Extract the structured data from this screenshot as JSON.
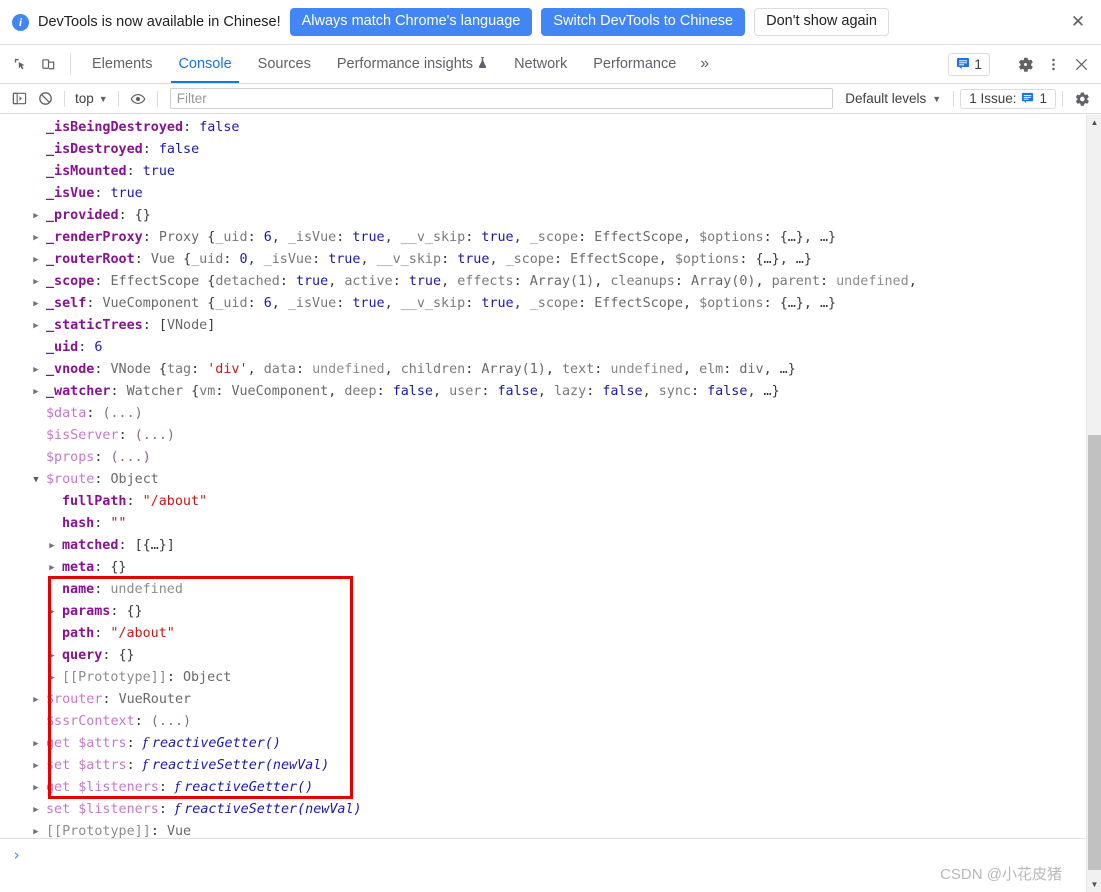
{
  "banner": {
    "icon": "info-icon",
    "message": "DevTools is now available in Chinese!",
    "buttons": [
      {
        "label": "Always match Chrome's language",
        "style": "primary"
      },
      {
        "label": "Switch DevTools to Chinese",
        "style": "primary"
      },
      {
        "label": "Don't show again",
        "style": "ghost"
      }
    ],
    "close_label": "✕"
  },
  "tabbar": {
    "inspect_icon": "inspect-element-icon",
    "device_icon": "device-toolbar-icon",
    "tabs": [
      {
        "label": "Elements",
        "active": false
      },
      {
        "label": "Console",
        "active": true
      },
      {
        "label": "Sources",
        "active": false
      },
      {
        "label": "Performance insights",
        "active": false,
        "badge_icon": "experiment-flask-icon"
      },
      {
        "label": "Network",
        "active": false
      },
      {
        "label": "Performance",
        "active": false
      }
    ],
    "more_label": "»",
    "issue_icon": "issue-message-icon",
    "issue_count": "1",
    "settings_icon": "gear-icon",
    "more_options_icon": "kebab-menu-icon",
    "close_icon": "close-icon"
  },
  "filterbar": {
    "sidebar_icon": "console-sidebar-icon",
    "clear_icon": "clear-console-icon",
    "context": "top",
    "eye_icon": "live-expression-eye-icon",
    "filter_placeholder": "Filter",
    "filter_value": "",
    "levels_label": "Default levels",
    "issue_label": "1 Issue:",
    "issue_icon": "issue-message-icon",
    "issue_count": "1",
    "settings_icon": "console-settings-gear-icon"
  },
  "console": {
    "lines": [
      {
        "id": "l1",
        "indent": 1,
        "arrow": "none",
        "name": "_isBeingDestroyed",
        "nameStyle": "k",
        "sep": ": ",
        "value": "false",
        "valueStyle": "bool"
      },
      {
        "id": "l2",
        "indent": 1,
        "arrow": "none",
        "name": "_isDestroyed",
        "nameStyle": "k",
        "sep": ": ",
        "value": "false",
        "valueStyle": "bool"
      },
      {
        "id": "l3",
        "indent": 1,
        "arrow": "none",
        "name": "_isMounted",
        "nameStyle": "k",
        "sep": ": ",
        "value": "true",
        "valueStyle": "bool"
      },
      {
        "id": "l4",
        "indent": 1,
        "arrow": "none",
        "name": "_isVue",
        "nameStyle": "k",
        "sep": ": ",
        "value": "true",
        "valueStyle": "bool"
      },
      {
        "id": "l5",
        "indent": 1,
        "arrow": "collapsed",
        "name": "_provided",
        "nameStyle": "k",
        "sep": ": ",
        "value": "{}",
        "valueStyle": "punct"
      },
      {
        "id": "l6",
        "indent": 1,
        "arrow": "collapsed",
        "name": "_renderProxy",
        "nameStyle": "k",
        "sep": ": ",
        "valueStyle": "rich",
        "tokens": [
          [
            "cls",
            "Proxy "
          ],
          [
            "punct",
            "{"
          ],
          [
            "sub",
            "_uid"
          ],
          [
            "punct",
            ": "
          ],
          [
            "num",
            "6"
          ],
          [
            "punct",
            ", "
          ],
          [
            "sub",
            "_isVue"
          ],
          [
            "punct",
            ": "
          ],
          [
            "bool",
            "true"
          ],
          [
            "punct",
            ", "
          ],
          [
            "sub",
            "__v_skip"
          ],
          [
            "punct",
            ": "
          ],
          [
            "bool",
            "true"
          ],
          [
            "punct",
            ", "
          ],
          [
            "sub",
            "_scope"
          ],
          [
            "punct",
            ": "
          ],
          [
            "cls",
            "EffectScope"
          ],
          [
            "punct",
            ", "
          ],
          [
            "sub",
            "$options"
          ],
          [
            "punct",
            ": "
          ],
          [
            "punct",
            "{…}"
          ],
          [
            "punct",
            ", …}"
          ]
        ]
      },
      {
        "id": "l7",
        "indent": 1,
        "arrow": "collapsed",
        "name": "_routerRoot",
        "nameStyle": "k",
        "sep": ": ",
        "valueStyle": "rich",
        "tokens": [
          [
            "cls",
            "Vue "
          ],
          [
            "punct",
            "{"
          ],
          [
            "sub",
            "_uid"
          ],
          [
            "punct",
            ": "
          ],
          [
            "num",
            "0"
          ],
          [
            "punct",
            ", "
          ],
          [
            "sub",
            "_isVue"
          ],
          [
            "punct",
            ": "
          ],
          [
            "bool",
            "true"
          ],
          [
            "punct",
            ", "
          ],
          [
            "sub",
            "__v_skip"
          ],
          [
            "punct",
            ": "
          ],
          [
            "bool",
            "true"
          ],
          [
            "punct",
            ", "
          ],
          [
            "sub",
            "_scope"
          ],
          [
            "punct",
            ": "
          ],
          [
            "cls",
            "EffectScope"
          ],
          [
            "punct",
            ", "
          ],
          [
            "sub",
            "$options"
          ],
          [
            "punct",
            ": "
          ],
          [
            "punct",
            "{…}"
          ],
          [
            "punct",
            ", …}"
          ]
        ]
      },
      {
        "id": "l8",
        "indent": 1,
        "arrow": "collapsed",
        "name": "_scope",
        "nameStyle": "k",
        "sep": ": ",
        "valueStyle": "rich",
        "tokens": [
          [
            "cls",
            "EffectScope "
          ],
          [
            "punct",
            "{"
          ],
          [
            "sub",
            "detached"
          ],
          [
            "punct",
            ": "
          ],
          [
            "bool",
            "true"
          ],
          [
            "punct",
            ", "
          ],
          [
            "sub",
            "active"
          ],
          [
            "punct",
            ": "
          ],
          [
            "bool",
            "true"
          ],
          [
            "punct",
            ", "
          ],
          [
            "sub",
            "effects"
          ],
          [
            "punct",
            ": "
          ],
          [
            "cls",
            "Array(1)"
          ],
          [
            "punct",
            ", "
          ],
          [
            "sub",
            "cleanups"
          ],
          [
            "punct",
            ": "
          ],
          [
            "cls",
            "Array(0)"
          ],
          [
            "punct",
            ", "
          ],
          [
            "sub",
            "parent"
          ],
          [
            "punct",
            ": "
          ],
          [
            "undef",
            "undefined"
          ],
          [
            "punct",
            ","
          ]
        ]
      },
      {
        "id": "l9",
        "indent": 1,
        "arrow": "collapsed",
        "name": "_self",
        "nameStyle": "k",
        "sep": ": ",
        "valueStyle": "rich",
        "tokens": [
          [
            "cls",
            "VueComponent "
          ],
          [
            "punct",
            "{"
          ],
          [
            "sub",
            "_uid"
          ],
          [
            "punct",
            ": "
          ],
          [
            "num",
            "6"
          ],
          [
            "punct",
            ", "
          ],
          [
            "sub",
            "_isVue"
          ],
          [
            "punct",
            ": "
          ],
          [
            "bool",
            "true"
          ],
          [
            "punct",
            ", "
          ],
          [
            "sub",
            "__v_skip"
          ],
          [
            "punct",
            ": "
          ],
          [
            "bool",
            "true"
          ],
          [
            "punct",
            ", "
          ],
          [
            "sub",
            "_scope"
          ],
          [
            "punct",
            ": "
          ],
          [
            "cls",
            "EffectScope"
          ],
          [
            "punct",
            ", "
          ],
          [
            "sub",
            "$options"
          ],
          [
            "punct",
            ": "
          ],
          [
            "punct",
            "{…}"
          ],
          [
            "punct",
            ", …}"
          ]
        ]
      },
      {
        "id": "l10",
        "indent": 1,
        "arrow": "collapsed",
        "name": "_staticTrees",
        "nameStyle": "k",
        "sep": ": ",
        "valueStyle": "rich",
        "tokens": [
          [
            "punct",
            "["
          ],
          [
            "cls",
            "VNode"
          ],
          [
            "punct",
            "]"
          ]
        ]
      },
      {
        "id": "l11",
        "indent": 1,
        "arrow": "none",
        "name": "_uid",
        "nameStyle": "k",
        "sep": ": ",
        "value": "6",
        "valueStyle": "num"
      },
      {
        "id": "l12",
        "indent": 1,
        "arrow": "collapsed",
        "name": "_vnode",
        "nameStyle": "k",
        "sep": ": ",
        "valueStyle": "rich",
        "tokens": [
          [
            "cls",
            "VNode "
          ],
          [
            "punct",
            "{"
          ],
          [
            "sub",
            "tag"
          ],
          [
            "punct",
            ": "
          ],
          [
            "str",
            "'div'"
          ],
          [
            "punct",
            ", "
          ],
          [
            "sub",
            "data"
          ],
          [
            "punct",
            ": "
          ],
          [
            "undef",
            "undefined"
          ],
          [
            "punct",
            ", "
          ],
          [
            "sub",
            "children"
          ],
          [
            "punct",
            ": "
          ],
          [
            "cls",
            "Array(1)"
          ],
          [
            "punct",
            ", "
          ],
          [
            "sub",
            "text"
          ],
          [
            "punct",
            ": "
          ],
          [
            "undef",
            "undefined"
          ],
          [
            "punct",
            ", "
          ],
          [
            "sub",
            "elm"
          ],
          [
            "punct",
            ": "
          ],
          [
            "cls",
            "div"
          ],
          [
            "punct",
            ", …}"
          ]
        ]
      },
      {
        "id": "l13",
        "indent": 1,
        "arrow": "collapsed",
        "name": "_watcher",
        "nameStyle": "k",
        "sep": ": ",
        "valueStyle": "rich",
        "tokens": [
          [
            "cls",
            "Watcher "
          ],
          [
            "punct",
            "{"
          ],
          [
            "sub",
            "vm"
          ],
          [
            "punct",
            ": "
          ],
          [
            "cls",
            "VueComponent"
          ],
          [
            "punct",
            ", "
          ],
          [
            "sub",
            "deep"
          ],
          [
            "punct",
            ": "
          ],
          [
            "bool",
            "false"
          ],
          [
            "punct",
            ", "
          ],
          [
            "sub",
            "user"
          ],
          [
            "punct",
            ": "
          ],
          [
            "bool",
            "false"
          ],
          [
            "punct",
            ", "
          ],
          [
            "sub",
            "lazy"
          ],
          [
            "punct",
            ": "
          ],
          [
            "bool",
            "false"
          ],
          [
            "punct",
            ", "
          ],
          [
            "sub",
            "sync"
          ],
          [
            "punct",
            ": "
          ],
          [
            "bool",
            "false"
          ],
          [
            "punct",
            ", …}"
          ]
        ]
      },
      {
        "id": "l14",
        "indent": 1,
        "arrow": "none",
        "name": "$data",
        "nameStyle": "k-dim",
        "sep": ": ",
        "value": "(...)",
        "valueStyle": "dots"
      },
      {
        "id": "l15",
        "indent": 1,
        "arrow": "none",
        "name": "$isServer",
        "nameStyle": "k-dim",
        "sep": ": ",
        "value": "(...)",
        "valueStyle": "dots"
      },
      {
        "id": "l16",
        "indent": 1,
        "arrow": "none",
        "name": "$props",
        "nameStyle": "k-dim",
        "sep": ": ",
        "value": "(...)",
        "valueStyle": "dots"
      },
      {
        "id": "l17",
        "indent": 1,
        "arrow": "expanded",
        "name": "$route",
        "nameStyle": "k-dim",
        "sep": ": ",
        "value": "Object",
        "valueStyle": "cls"
      },
      {
        "id": "l18",
        "indent": 2,
        "arrow": "none",
        "name": "fullPath",
        "nameStyle": "k",
        "sep": ": ",
        "value": "\"/about\"",
        "valueStyle": "str"
      },
      {
        "id": "l19",
        "indent": 2,
        "arrow": "none",
        "name": "hash",
        "nameStyle": "k",
        "sep": ": ",
        "value": "\"\"",
        "valueStyle": "str"
      },
      {
        "id": "l20",
        "indent": 2,
        "arrow": "collapsed",
        "name": "matched",
        "nameStyle": "k",
        "sep": ": ",
        "value": "[{…}]",
        "valueStyle": "punct"
      },
      {
        "id": "l21",
        "indent": 2,
        "arrow": "collapsed",
        "name": "meta",
        "nameStyle": "k",
        "sep": ": ",
        "value": "{}",
        "valueStyle": "punct"
      },
      {
        "id": "l22",
        "indent": 2,
        "arrow": "none",
        "name": "name",
        "nameStyle": "k",
        "sep": ": ",
        "value": "undefined",
        "valueStyle": "undef"
      },
      {
        "id": "l23",
        "indent": 2,
        "arrow": "collapsed",
        "name": "params",
        "nameStyle": "k",
        "sep": ": ",
        "value": "{}",
        "valueStyle": "punct"
      },
      {
        "id": "l24",
        "indent": 2,
        "arrow": "none",
        "name": "path",
        "nameStyle": "k",
        "sep": ": ",
        "value": "\"/about\"",
        "valueStyle": "str"
      },
      {
        "id": "l25",
        "indent": 2,
        "arrow": "collapsed",
        "name": "query",
        "nameStyle": "k",
        "sep": ": ",
        "value": "{}",
        "valueStyle": "punct"
      },
      {
        "id": "l26",
        "indent": 2,
        "arrow": "collapsed",
        "name": "[[Prototype]]",
        "nameStyle": "proto",
        "sep": ": ",
        "value": "Object",
        "valueStyle": "cls"
      },
      {
        "id": "l27",
        "indent": 1,
        "arrow": "collapsed",
        "name": "$router",
        "nameStyle": "k-dim",
        "sep": ": ",
        "value": "VueRouter",
        "valueStyle": "cls"
      },
      {
        "id": "l28",
        "indent": 1,
        "arrow": "none",
        "name": "$ssrContext",
        "nameStyle": "k-dim",
        "sep": ": ",
        "value": "(...)",
        "valueStyle": "dots"
      },
      {
        "id": "l29",
        "indent": 1,
        "arrow": "collapsed",
        "name": "get $attrs",
        "nameStyle": "k-dim",
        "sep": ": ",
        "valueStyle": "fnrich",
        "fnName": "reactiveGetter()"
      },
      {
        "id": "l30",
        "indent": 1,
        "arrow": "collapsed",
        "name": "set $attrs",
        "nameStyle": "k-dim",
        "sep": ": ",
        "valueStyle": "fnrich",
        "fnName": "reactiveSetter(newVal)"
      },
      {
        "id": "l31",
        "indent": 1,
        "arrow": "collapsed",
        "name": "get $listeners",
        "nameStyle": "k-dim",
        "sep": ": ",
        "valueStyle": "fnrich",
        "fnName": "reactiveGetter()"
      },
      {
        "id": "l32",
        "indent": 1,
        "arrow": "collapsed",
        "name": "set $listeners",
        "nameStyle": "k-dim",
        "sep": ": ",
        "valueStyle": "fnrich",
        "fnName": "reactiveSetter(newVal)"
      },
      {
        "id": "l33",
        "indent": 1,
        "arrow": "collapsed",
        "name": "[[Prototype]]",
        "nameStyle": "proto",
        "sep": ": ",
        "value": "Vue",
        "valueStyle": "cls"
      }
    ],
    "highlight_box": {
      "color": "#e60000",
      "around": "$route"
    }
  },
  "prompt": {
    "caret": "›",
    "value": ""
  },
  "watermark": "CSDN @小花皮猪",
  "colors": {
    "accent_blue": "#4285f4",
    "tab_active": "#1a73e8",
    "highlight_red": "#e60000",
    "property_purple": "#881391",
    "string_red": "#c41a16",
    "value_blue": "#1a1aa6"
  }
}
